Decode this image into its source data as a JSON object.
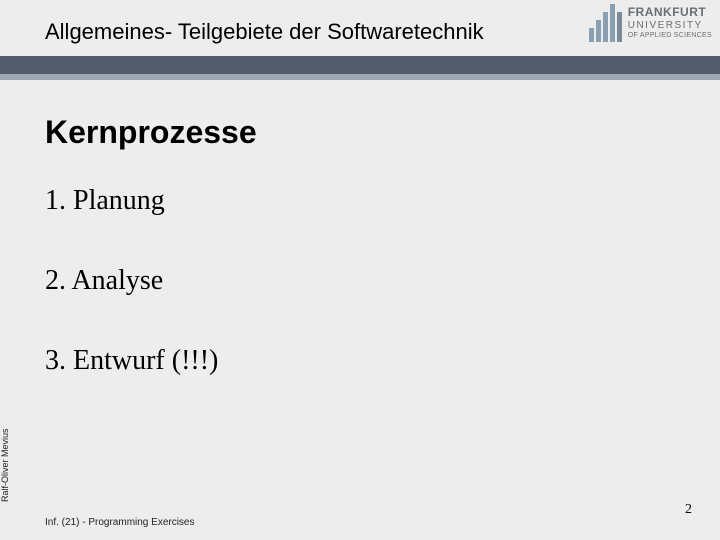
{
  "header": {
    "title": "Allgemeines- Teilgebiete der Softwaretechnik"
  },
  "logo": {
    "line1": "FRANKFURT",
    "line2": "UNIVERSITY",
    "line3": "OF APPLIED SCIENCES"
  },
  "content": {
    "heading": "Kernprozesse",
    "items": [
      "1. Planung",
      "2. Analyse",
      "3. Entwurf (!!!)"
    ]
  },
  "sidebar": {
    "author": "Ralf-Oliver Mevius"
  },
  "footer": {
    "left": "Inf. (21) - Programming Exercises",
    "page": "2"
  }
}
